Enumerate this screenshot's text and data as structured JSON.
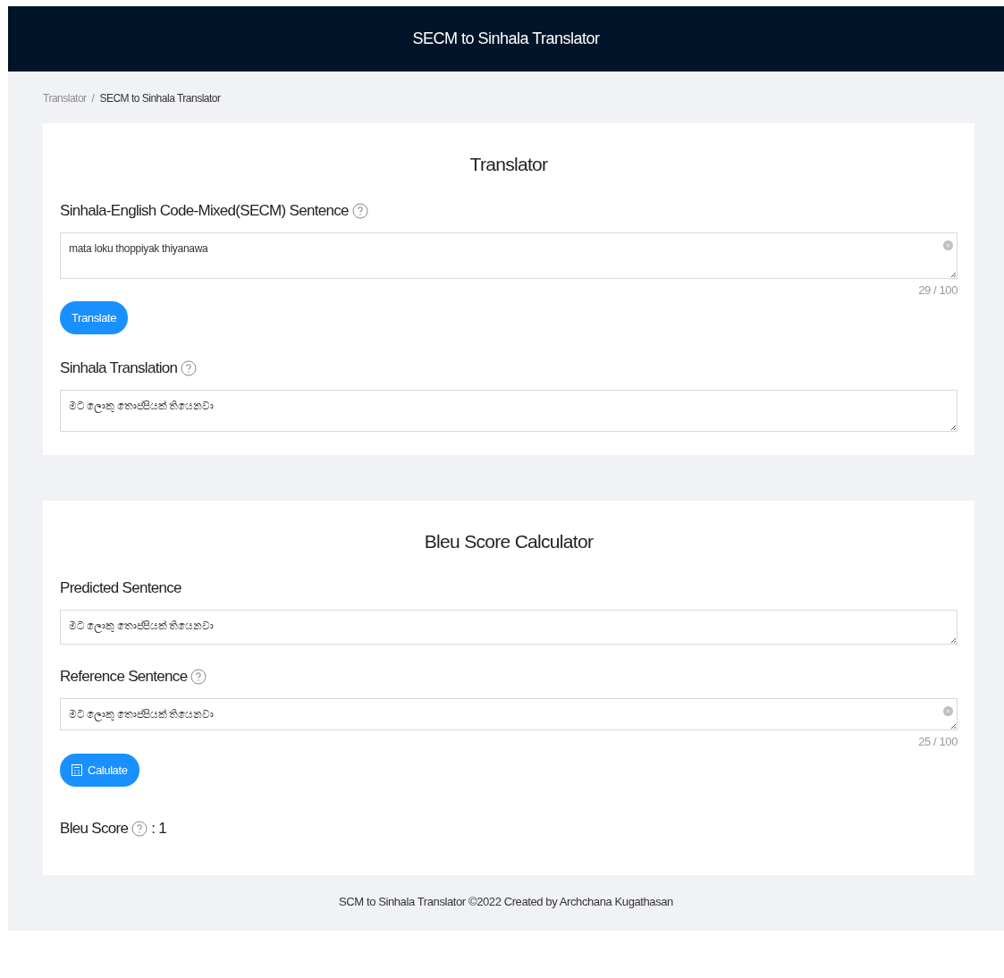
{
  "header": {
    "title": "SECM to Sinhala Translator"
  },
  "breadcrumb": [
    {
      "label": "Translator",
      "current": false
    },
    {
      "label": "SECM to Sinhala Translator",
      "current": true
    }
  ],
  "breadcrumb_separator": "/",
  "translator": {
    "title": "Translator",
    "fields": [
      {
        "label": "Sinhala-English Code-Mixed(SECM) Sentence",
        "help": true,
        "value": "mata loku thoppiyak thiyanawa",
        "clearable": true,
        "count": "29 / 100"
      },
      {
        "label": "Sinhala Translation",
        "help": true,
        "value": "මට ලොකු තොප්පියක් තියෙනවා",
        "clearable": false
      }
    ],
    "button": {
      "label": "Translate",
      "icon": false
    }
  },
  "bleu": {
    "title": "Bleu Score Calculator",
    "fields": [
      {
        "label": "Predicted Sentence",
        "help": false,
        "value": "මට ලොකු තොප්පියක් තියෙනවා",
        "clearable": false
      },
      {
        "label": "Reference Sentence",
        "help": true,
        "value": "මට ලොකු තොප්පියක් තියෙනවා",
        "clearable": true,
        "count": "25 / 100"
      }
    ],
    "button": {
      "label": "Calulate",
      "icon": true
    },
    "result": {
      "label": "Bleu Score",
      "help": true,
      "value": ": 1"
    }
  },
  "footer": {
    "text": "SCM to Sinhala Translator ©2022 Created by Archchana Kugathasan"
  }
}
